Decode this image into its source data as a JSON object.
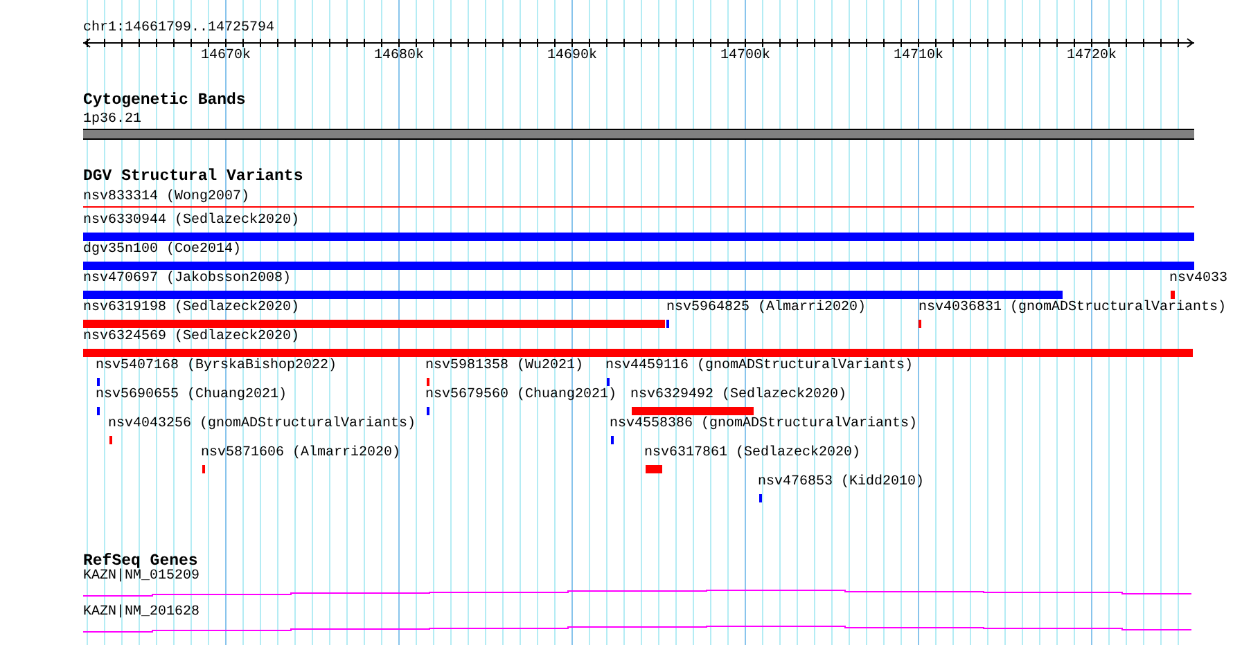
{
  "ruler": {
    "location": "chr1:14661799..14725794",
    "ticks": [
      "14670k",
      "14680k",
      "14690k",
      "14700k",
      "14710k",
      "14720k"
    ]
  },
  "tracks": [
    {
      "kind": "bands",
      "title": "Cytogenetic Bands",
      "band": "1p36.21"
    },
    {
      "kind": "variants",
      "title": "DGV Structural Variants",
      "rows": [
        {
          "features": [
            {
              "label": "nsv833314 (Wong2007)",
              "color": "#ff0000",
              "kind": "line"
            }
          ]
        },
        {
          "features": [
            {
              "label": "nsv6330944 (Sedlazeck2020)",
              "color": "#0000ff",
              "kind": "bar"
            }
          ]
        },
        {
          "features": [
            {
              "label": "dgv35n100 (Coe2014)",
              "color": "#0000ff",
              "kind": "bar"
            }
          ]
        },
        {
          "features": [
            {
              "label": "nsv470697 (Jakobsson2008)",
              "color": "#0000ff",
              "kind": "bar"
            },
            {
              "label": "nsv4033",
              "color": "#ff0000",
              "kind": "bar"
            }
          ]
        },
        {
          "features": [
            {
              "label": "nsv6319198 (Sedlazeck2020)",
              "color": "#ff0000",
              "kind": "bar"
            },
            {
              "label": "nsv5964825 (Almarri2020)",
              "color": "#0000ff",
              "kind": "bar"
            },
            {
              "label": "nsv4036831 (gnomADStructuralVariants)",
              "color": "#ff0000",
              "kind": "bar"
            }
          ]
        },
        {
          "features": [
            {
              "label": "nsv6324569 (Sedlazeck2020)",
              "color": "#ff0000",
              "kind": "bar"
            }
          ]
        },
        {
          "features": [
            {
              "label": "nsv5407168 (ByrskaBishop2022)",
              "color": "#0000ff",
              "kind": "bar"
            },
            {
              "label": "nsv5981358 (Wu2021)",
              "color": "#ff0000",
              "kind": "bar"
            },
            {
              "label": "nsv4459116 (gnomADStructuralVariants)",
              "color": "#0000ff",
              "kind": "bar"
            }
          ]
        },
        {
          "features": [
            {
              "label": "nsv5690655 (Chuang2021)",
              "color": "#0000ff",
              "kind": "bar"
            },
            {
              "label": "nsv5679560 (Chuang2021)",
              "color": "#0000ff",
              "kind": "bar"
            },
            {
              "label": "nsv6329492 (Sedlazeck2020)",
              "color": "#ff0000",
              "kind": "bar"
            }
          ]
        },
        {
          "features": [
            {
              "label": "nsv4043256 (gnomADStructuralVariants)",
              "color": "#ff0000",
              "kind": "bar"
            },
            {
              "label": "nsv4558386 (gnomADStructuralVariants)",
              "color": "#0000ff",
              "kind": "bar"
            }
          ]
        },
        {
          "features": [
            {
              "label": "nsv5871606 (Almarri2020)",
              "color": "#ff0000",
              "kind": "bar"
            },
            {
              "label": "nsv6317861 (Sedlazeck2020)",
              "color": "#ff0000",
              "kind": "bar"
            }
          ]
        },
        {
          "features": [
            {
              "label": "nsv476853 (Kidd2010)",
              "color": "#0000ff",
              "kind": "bar"
            }
          ]
        }
      ]
    },
    {
      "kind": "genes",
      "title": "RefSeq Genes",
      "genes": [
        "KAZN|NM_015209",
        "KAZN|NM_201628"
      ]
    }
  ]
}
